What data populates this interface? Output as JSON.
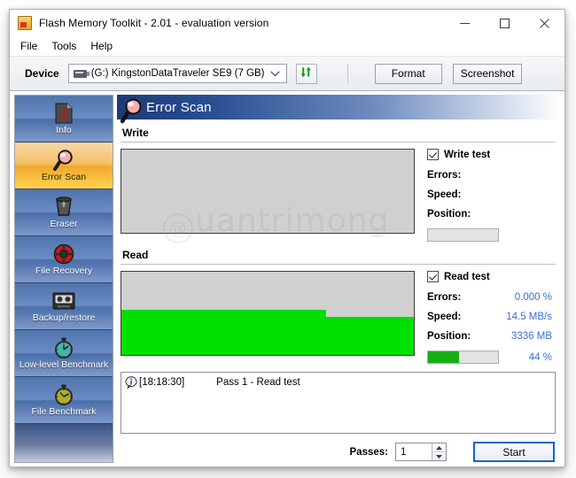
{
  "window": {
    "title": "Flash Memory Toolkit - 2.01 - evaluation version",
    "app_icon": "flash-drive-icon",
    "minimize_label": "–",
    "maximize_label": "□",
    "close_label": "✕"
  },
  "menu": {
    "items": [
      {
        "label": "File"
      },
      {
        "label": "Tools"
      },
      {
        "label": "Help"
      }
    ]
  },
  "toolbar": {
    "device_label": "Device",
    "device_selected": "(G:) KingstonDataTraveler SE9 (7 GB)",
    "device_icon": "usb-drive-icon",
    "refresh_icon": "refresh-icon",
    "format_label": "Format",
    "screenshot_label": "Screenshot"
  },
  "sidebar": {
    "items": [
      {
        "label": "Info",
        "icon": "info-card-icon",
        "selected": false
      },
      {
        "label": "Error Scan",
        "icon": "magnifier-icon",
        "selected": true
      },
      {
        "label": "Eraser",
        "icon": "trash-can-icon",
        "selected": false
      },
      {
        "label": "File Recovery",
        "icon": "life-ring-icon",
        "selected": false
      },
      {
        "label": "Backup/restore",
        "icon": "cassette-tape-icon",
        "selected": false
      },
      {
        "label": "Low-level Benchmark",
        "icon": "stopwatch-teal-icon",
        "selected": false
      },
      {
        "label": "File Benchmark",
        "icon": "stopwatch-olive-icon",
        "selected": false
      }
    ]
  },
  "panel": {
    "title": "Error Scan",
    "title_icon": "magnifier-icon"
  },
  "write_section": {
    "title": "Write",
    "checkbox_label": "Write test",
    "checked": true,
    "errors_label": "Errors:",
    "errors_value": "",
    "speed_label": "Speed:",
    "speed_value": "",
    "position_label": "Position:",
    "position_value": "",
    "percent_value": "",
    "progress_percent": 0,
    "graph_percent": 0
  },
  "read_section": {
    "title": "Read",
    "checkbox_label": "Read test",
    "checked": true,
    "errors_label": "Errors:",
    "errors_value": "0.000 %",
    "speed_label": "Speed:",
    "speed_value": "14.5 MB/s",
    "position_label": "Position:",
    "position_value": "3336 MB",
    "percent_value": "44 %",
    "progress_percent": 44,
    "graph_fill_left_percent": 54,
    "graph_fill_right_percent": 46
  },
  "log": {
    "entries": [
      {
        "icon": "info-balloon-icon",
        "time": "[18:18:30]",
        "message": "Pass 1 - Read test"
      }
    ]
  },
  "footer": {
    "passes_label": "Passes:",
    "passes_value": "1",
    "start_label": "Start"
  },
  "watermark": {
    "text": "uantrimong",
    "at_symbol": "@"
  },
  "colors": {
    "accent_blue": "#3a6fd8",
    "graph_green": "#00e000",
    "progress_green": "#14b014",
    "header_blue": "#1c3a78",
    "selected_orange": "#f0a92f"
  }
}
